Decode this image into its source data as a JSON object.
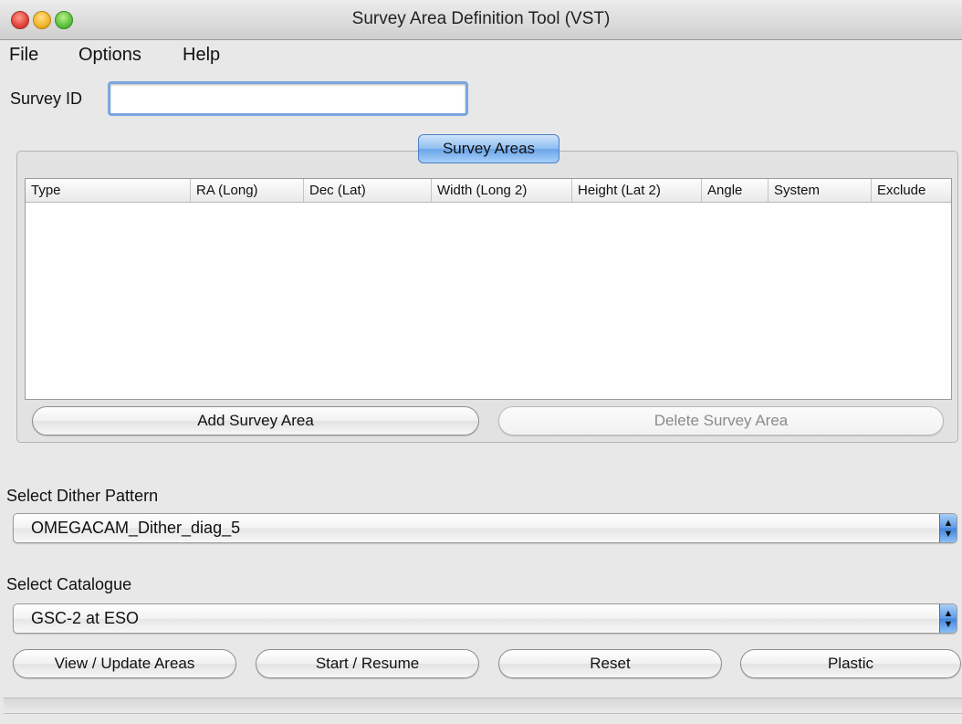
{
  "window": {
    "title": "Survey Area Definition Tool (VST)"
  },
  "menu": {
    "file": "File",
    "options": "Options",
    "help": "Help"
  },
  "survey_id": {
    "label": "Survey ID",
    "value": ""
  },
  "survey_areas": {
    "tab_label": "Survey Areas",
    "columns": [
      "Type",
      "RA (Long)",
      "Dec (Lat)",
      "Width (Long 2)",
      "Height (Lat 2)",
      "Angle",
      "System",
      "Exclude"
    ],
    "rows": [],
    "add_button": "Add Survey Area",
    "delete_button": "Delete Survey Area",
    "delete_enabled": false
  },
  "dither": {
    "label": "Select Dither Pattern",
    "selected": "OMEGACAM_Dither_diag_5"
  },
  "catalogue": {
    "label": "Select Catalogue",
    "selected": "GSC-2 at ESO"
  },
  "actions": {
    "view_update": "View / Update Areas",
    "start_resume": "Start / Resume",
    "reset": "Reset",
    "plastic": "Plastic"
  },
  "colors": {
    "accent": "#6aa4e8",
    "close": "#e0443a",
    "minimize": "#f0b429",
    "maximize": "#5cc13d"
  }
}
